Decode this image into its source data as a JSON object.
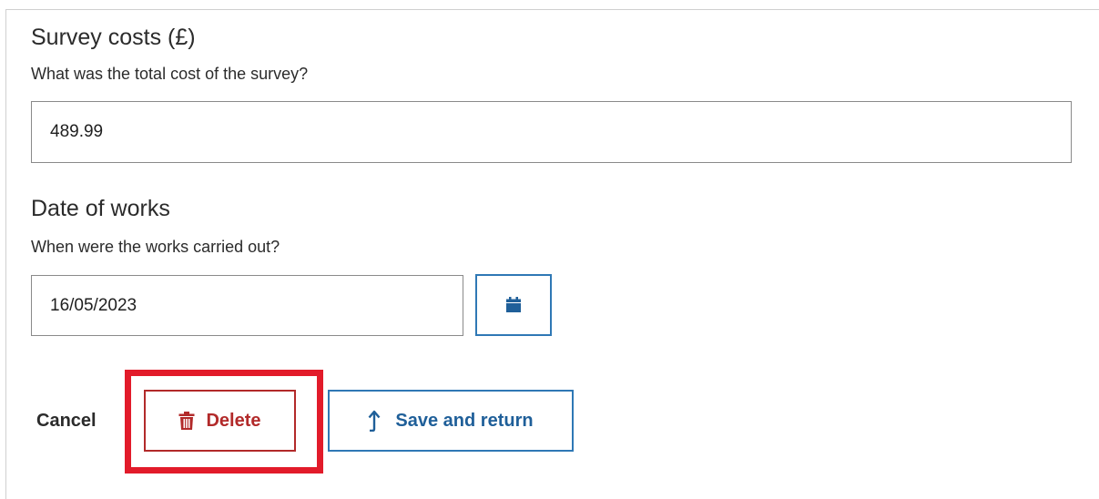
{
  "survey": {
    "title": "Survey costs (£)",
    "hint": "What was the total cost of the survey?",
    "value": "489.99"
  },
  "date": {
    "title": "Date of works",
    "hint": "When were the works carried out?",
    "value": "16/05/2023"
  },
  "icons": {
    "calendar": "calendar-icon",
    "trash": "trash-icon",
    "save": "arrow-up-return-icon"
  },
  "actions": {
    "cancel_label": "Cancel",
    "delete_label": "Delete",
    "save_label": "Save and return"
  },
  "colors": {
    "primary": "#2f78b5",
    "danger": "#b22a2a",
    "highlight": "#e21b2a"
  }
}
